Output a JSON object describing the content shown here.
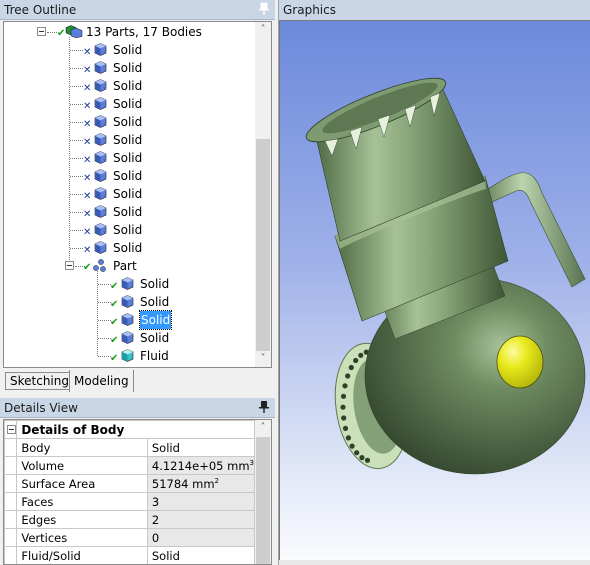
{
  "tree_outline": {
    "title": "Tree Outline",
    "root": {
      "label": "13 Parts, 17 Bodies",
      "status": "check",
      "icon": "multi-body-icon",
      "expanded": true
    },
    "bodies": [
      {
        "label": "Solid",
        "status": "suppressed",
        "icon": "solid-body-icon"
      },
      {
        "label": "Solid",
        "status": "suppressed",
        "icon": "solid-body-icon"
      },
      {
        "label": "Solid",
        "status": "suppressed",
        "icon": "solid-body-icon"
      },
      {
        "label": "Solid",
        "status": "suppressed",
        "icon": "solid-body-icon"
      },
      {
        "label": "Solid",
        "status": "suppressed",
        "icon": "solid-body-icon"
      },
      {
        "label": "Solid",
        "status": "suppressed",
        "icon": "solid-body-icon"
      },
      {
        "label": "Solid",
        "status": "suppressed",
        "icon": "solid-body-icon"
      },
      {
        "label": "Solid",
        "status": "suppressed",
        "icon": "solid-body-icon"
      },
      {
        "label": "Solid",
        "status": "suppressed",
        "icon": "solid-body-icon"
      },
      {
        "label": "Solid",
        "status": "suppressed",
        "icon": "solid-body-icon"
      },
      {
        "label": "Solid",
        "status": "suppressed",
        "icon": "solid-body-icon"
      },
      {
        "label": "Solid",
        "status": "suppressed",
        "icon": "solid-body-icon"
      }
    ],
    "part": {
      "label": "Part",
      "status": "check",
      "icon": "part-icon",
      "expanded": true,
      "children": [
        {
          "label": "Solid",
          "status": "check",
          "icon": "solid-body-icon",
          "selected": false
        },
        {
          "label": "Solid",
          "status": "check",
          "icon": "solid-body-icon",
          "selected": false
        },
        {
          "label": "Solid",
          "status": "check",
          "icon": "solid-body-icon",
          "selected": true
        },
        {
          "label": "Solid",
          "status": "check",
          "icon": "solid-body-icon",
          "selected": false
        },
        {
          "label": "Fluid",
          "status": "check",
          "icon": "fluid-body-icon",
          "selected": false
        }
      ]
    }
  },
  "tabs": [
    {
      "label": "Sketching",
      "active": false
    },
    {
      "label": "Modeling",
      "active": true
    }
  ],
  "details_view": {
    "title": "Details View",
    "group": "Details of Body",
    "rows": [
      {
        "key": "Body",
        "value": "Solid",
        "editable": true
      },
      {
        "key": "Volume",
        "value": "4.1214e+05 mm",
        "unit_sup": "3",
        "editable": false
      },
      {
        "key": "Surface Area",
        "value": "51784 mm",
        "unit_sup": "2",
        "editable": false
      },
      {
        "key": "Faces",
        "value": "3",
        "editable": false
      },
      {
        "key": "Edges",
        "value": "2",
        "editable": false
      },
      {
        "key": "Vertices",
        "value": "0",
        "editable": false
      },
      {
        "key": "Fluid/Solid",
        "value": "Solid",
        "editable": true
      }
    ]
  },
  "graphics": {
    "title": "Graphics",
    "model": "valve-assembly-3d",
    "colors": {
      "body": "#7f9a72",
      "highlight": "#e8ea1c",
      "flange": "#c9e0b8"
    }
  },
  "colors": {
    "header_bg": "#c9d6e5",
    "selection": "#3399ff",
    "viewport_top": "#6c89dc",
    "viewport_bottom": "#fbfcfe"
  }
}
